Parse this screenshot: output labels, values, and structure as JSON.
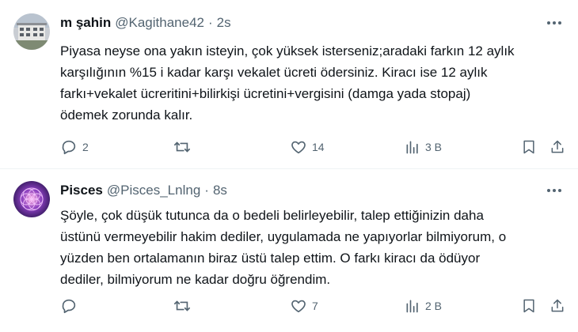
{
  "tweets": [
    {
      "display_name": "m şahin",
      "handle": "@Kagithane42",
      "separator": "·",
      "time": "2s",
      "text": "Piyasa neyse ona yakın isteyin, çok yüksek isterseniz;aradaki farkın 12 aylık\nkarşılığının %15 i kadar karşı vekalet ücreti ödersiniz. Kiracı ise 12 aylık\nfarkı+vekalet ücreritini+bilirkişi ücretini+vergisini (damga yada stopaj)\nödemek zorunda kalır.",
      "avatar_icon": "building-photo",
      "actions": {
        "replies": "2",
        "retweets": "",
        "likes": "14",
        "views": "3 B"
      }
    },
    {
      "display_name": "Pisces",
      "handle": "@Pisces_Lnlng",
      "separator": "·",
      "time": "8s",
      "text": "Şöyle, çok düşük tutunca da o bedeli belirleyebilir,  talep ettiğinizin daha\nüstünü vermeyebilir hakim dediler, uygulamada ne yapıyorlar bilmiyorum, o\nyüzden ben ortalamanın biraz üstü talep ettim. O farkı kiracı da ödüyor\ndediler, bilmiyorum ne kadar doğru öğrendim.",
      "avatar_icon": "flower-of-life-pattern",
      "actions": {
        "replies": "",
        "retweets": "",
        "likes": "7",
        "views": "2 B"
      }
    }
  ],
  "colors": {
    "text": "#0f1419",
    "secondary": "#536471",
    "divider": "#eff3f4"
  }
}
